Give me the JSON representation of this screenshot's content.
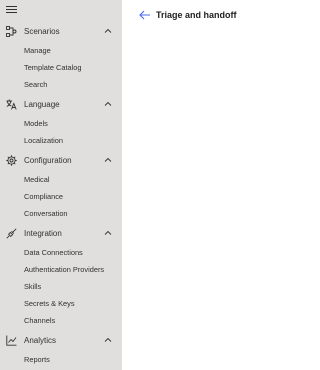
{
  "sidebar": {
    "menu_icon": "hamburger-menu-icon",
    "sections": [
      {
        "label": "Scenarios",
        "icon": "flow-icon",
        "expanded": true,
        "items": [
          "Manage",
          "Template Catalog",
          "Search"
        ]
      },
      {
        "label": "Language",
        "icon": "language-icon",
        "expanded": true,
        "items": [
          "Models",
          "Localization"
        ]
      },
      {
        "label": "Configuration",
        "icon": "gear-icon",
        "expanded": true,
        "items": [
          "Medical",
          "Compliance",
          "Conversation"
        ]
      },
      {
        "label": "Integration",
        "icon": "plug-icon",
        "expanded": true,
        "items": [
          "Data Connections",
          "Authentication Providers",
          "Skills",
          "Secrets & Keys",
          "Channels"
        ]
      },
      {
        "label": "Analytics",
        "icon": "chart-icon",
        "expanded": true,
        "items": [
          "Reports"
        ]
      }
    ]
  },
  "main": {
    "title": "Triage and handoff",
    "back_icon": "back-arrow-icon"
  },
  "colors": {
    "sidebar_bg": "#e1dfdd",
    "accent": "#4f6bed",
    "text": "#323130"
  }
}
